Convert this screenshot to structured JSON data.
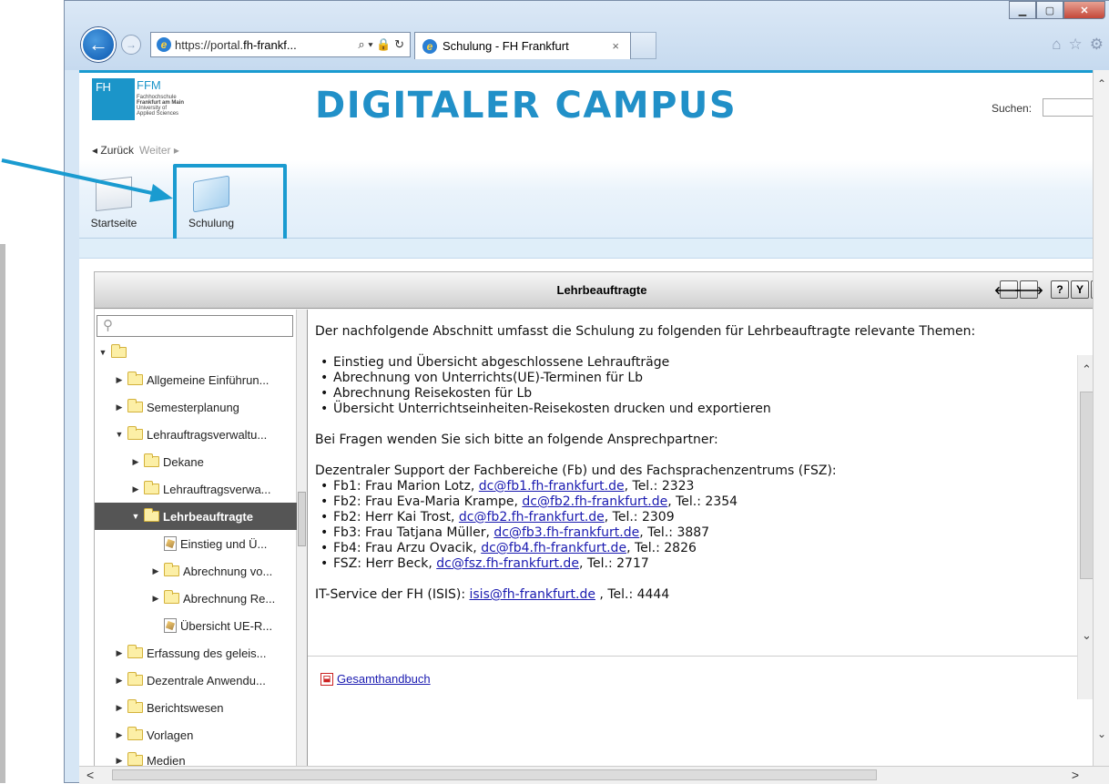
{
  "browser": {
    "url_prefix": "https://portal.",
    "url_domain": "fh-frankf...",
    "addr_icons": "⌕ ▾ 🔒 ↻",
    "tab_title": "Schulung - FH Frankfurt",
    "tab_close": "×",
    "window_buttons": {
      "minimize": "▁",
      "maximize": "▢",
      "close": "✕"
    },
    "toolbar_icons": [
      "home-icon",
      "star-icon",
      "gear-icon"
    ]
  },
  "portal": {
    "logo_fh": "FH",
    "logo_ffm": "FFM",
    "logo_sub1": "Fachhochschule",
    "logo_sub2": "Frankfurt am Main",
    "logo_sub3": "University of",
    "logo_sub4": "Applied Sciences",
    "title": "DIGITALER CAMPUS",
    "search_label": "Suchen:",
    "back": "◂ Zurück",
    "forward": "Weiter ▸",
    "ribbon": [
      {
        "label": "Startseite"
      },
      {
        "label": "Schulung"
      }
    ]
  },
  "panel": {
    "title": "Lehrbeauftragte",
    "buttons": [
      "🡐",
      "🡒",
      "?",
      "Y",
      "X"
    ]
  },
  "tree": {
    "search_glyph": "⚲",
    "items": [
      {
        "label": "Allgemeine Einführun..."
      },
      {
        "label": "Semesterplanung"
      },
      {
        "label": "Lehrauftragsverwaltu..."
      },
      {
        "label": "Dekane"
      },
      {
        "label": "Lehrauftragsverwa..."
      },
      {
        "label": "Lehrbeauftragte"
      },
      {
        "label": "Einstieg und Ü..."
      },
      {
        "label": "Abrechnung vo..."
      },
      {
        "label": "Abrechnung Re..."
      },
      {
        "label": "Übersicht UE-R..."
      },
      {
        "label": "Erfassung des geleis..."
      },
      {
        "label": "Dezentrale Anwendu..."
      },
      {
        "label": "Berichtswesen"
      },
      {
        "label": "Vorlagen"
      },
      {
        "label": "Medien"
      }
    ]
  },
  "content": {
    "intro": "Der nachfolgende Abschnitt umfasst die Schulung zu folgenden für Lehrbeauftragte relevante Themen:",
    "topics": [
      "Einstieg und Übersicht abgeschlossene Lehraufträge",
      "Abrechnung von Unterrichts(UE)-Terminen für Lb",
      "Abrechnung Reisekosten für Lb",
      "Übersicht Unterrichtseinheiten-Reisekosten drucken und exportieren"
    ],
    "questions": "Bei Fragen wenden Sie sich bitte an folgende Ansprechpartner:",
    "support_heading": "Dezentraler Support der Fachbereiche (Fb) und des Fachsprachenzentrums (FSZ):",
    "contacts": [
      {
        "prefix": "Fb1: Frau Marion Lotz, ",
        "email": "dc@fb1.fh-frankfurt.de",
        "suffix": ", Tel.: 2323"
      },
      {
        "prefix": "Fb2: Frau Eva-Maria Krampe, ",
        "email": "dc@fb2.fh-frankfurt.de",
        "suffix": ", Tel.: 2354"
      },
      {
        "prefix": "Fb2: Herr Kai Trost, ",
        "email": "dc@fb2.fh-frankfurt.de",
        "suffix": ", Tel.: 2309"
      },
      {
        "prefix": "Fb3: Frau Tatjana Müller, ",
        "email": "dc@fb3.fh-frankfurt.de",
        "suffix": ", Tel.: 3887"
      },
      {
        "prefix": "Fb4: Frau Arzu Ovacik, ",
        "email": "dc@fb4.fh-frankfurt.de",
        "suffix": ", Tel.: 2826"
      },
      {
        "prefix": "FSZ: Herr Beck, ",
        "email": "dc@fsz.fh-frankfurt.de",
        "suffix": ", Tel.: 2717"
      }
    ],
    "it_prefix": "IT-Service der FH (ISIS): ",
    "it_email": "isis@fh-frankfurt.de",
    "it_suffix": " , Tel.: 4444",
    "handbook": "Gesamthandbuch"
  },
  "colors": {
    "accent": "#1a9bd0",
    "title": "#2190c8",
    "selected": "#555555",
    "link": "#1a1ab0"
  }
}
